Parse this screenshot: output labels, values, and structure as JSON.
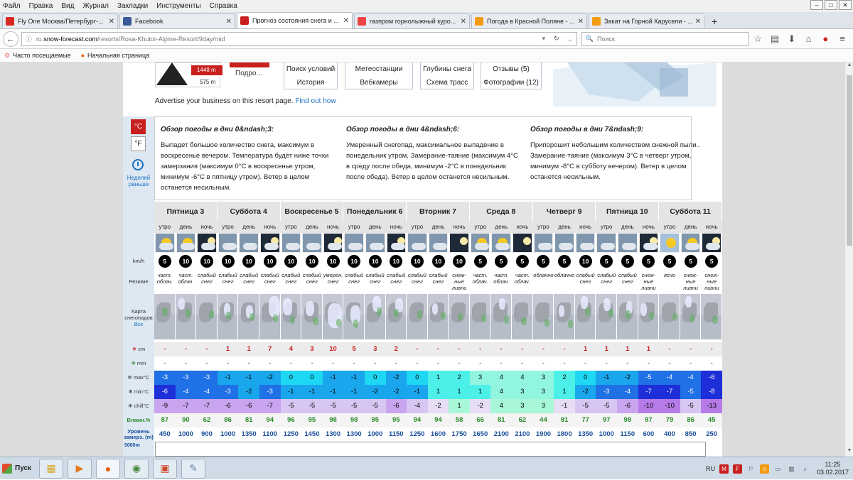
{
  "menu": [
    "Файл",
    "Правка",
    "Вид",
    "Журнал",
    "Закладки",
    "Инструменты",
    "Справка"
  ],
  "tabs": [
    {
      "label": "Fly One Москва/Петербург-...",
      "icon": "aeroflot-icon",
      "color": "#d82a20"
    },
    {
      "label": "Facebook",
      "icon": "facebook-icon",
      "color": "#3b5998"
    },
    {
      "label": "Прогноз состояния снега и ...",
      "icon": "snowforecast-icon",
      "color": "#c8201e",
      "active": true
    },
    {
      "label": "газпром горнолыжный курo...",
      "icon": "yandex-icon",
      "color": "#e44"
    },
    {
      "label": "Погода в Красной Поляне - ...",
      "icon": "weather-icon",
      "color": "#f39c12"
    },
    {
      "label": "Закат на Горной Карусели - ...",
      "icon": "weather-icon",
      "color": "#f39c12"
    }
  ],
  "nav": {
    "url_pre": "ru.",
    "url_host": "snow-forecast.com",
    "url_path": "/resorts/Rosa-Khutor-Alpine-Resort/9day/mid",
    "search_placeholder": "Поиск"
  },
  "bookmarks": [
    "Часто посещаемые",
    "Начальная страница"
  ],
  "header": {
    "elev_top": "1448 m",
    "elev_bottom": "575 m",
    "more": "Подро...",
    "buttons": [
      {
        "a": "Поиск условий",
        "b": "История"
      },
      {
        "a": "Метеостанции",
        "b": "Вебкамеры"
      },
      {
        "a": "Глубины снега",
        "b": "Схема трасс"
      },
      {
        "a": "Отзывы (5)",
        "b": "Фотографии (12)"
      }
    ],
    "advert_text": "Advertise your business on this resort page.",
    "advert_link": "Find out how"
  },
  "side": {
    "celsius": "°C",
    "fahrenheit": "°F",
    "weeks_label": "Неделей раньше"
  },
  "summary": [
    {
      "title": "Обзор погоды в дни 0&ndash;3:",
      "text": "Выпадет большое количество снега, максимум в воскресенье вечером. Температура будет ниже точки замерзания (максимум 0°C в воскресенье утром, минимум -6°C в пятницу утром). Ветер в целом останется несильным."
    },
    {
      "title": "Обзор погоды в дни 4&ndash;6:",
      "text": "Умеренный снегопад, максимальное выпадение в понедельник утром. Замерание-таяние (максимум 4°C в среду после обеда, минимум -2°C в понедельник после обеда). Ветер в целом останется несильным."
    },
    {
      "title": "Обзор погоды в дни 7&ndash;9:",
      "text": "Припорошит небольшим количеством снежной пыли.. Замерание-таяние (максимум 3°C в четверг утром, минимум -8°C в субботу вечером). Ветер в целом останется несильным."
    }
  ],
  "labels": {
    "wind": "km/h",
    "summary": "Резюме",
    "map": "Карта снегопадов",
    "map_all": "Все",
    "snow": "cm",
    "rain": "mm",
    "max": "max°C",
    "min": "min°C",
    "chill": "chill°C",
    "humid": "Влажн.%",
    "freeze": "Уровень замерз. (m)",
    "graph": "5000m"
  },
  "days": [
    "Пятница 3",
    "Суббота 4",
    "Воскресенье 5",
    "Понедельник 6",
    "Вторник 7",
    "Среда 8",
    "Четверг 9",
    "Пятница 10",
    "Суббота 11"
  ],
  "periods": [
    "утро",
    "день",
    "ночь"
  ],
  "icons": [
    "cloudsun",
    "cloudsun",
    "night",
    "snow",
    "snow",
    "snownight",
    "snow",
    "snow",
    "snownight",
    "snow",
    "snow",
    "snownight",
    "snow",
    "snow",
    "moon",
    "cloudsun",
    "cloudsun",
    "moon",
    "cloud",
    "cloud",
    "cloud",
    "snow",
    "snow",
    "snownight",
    "sun",
    "sunsnow",
    "snownight"
  ],
  "wind": [
    5,
    10,
    10,
    10,
    10,
    10,
    10,
    10,
    10,
    10,
    10,
    10,
    10,
    10,
    10,
    5,
    5,
    5,
    5,
    5,
    10,
    5,
    5,
    5,
    5,
    5,
    5
  ],
  "cond": [
    "част. облач.",
    "част. облач.",
    "слабый снег",
    "слабый снег",
    "слабый снег",
    "слабый снег",
    "слабый снег",
    "слабый снег",
    "умерен. снег",
    "слабый снег",
    "слабый снег",
    "слабый снег",
    "слабый снег",
    "слабый снег",
    "снеж-ные ливни",
    "част. облач.",
    "част. облач.",
    "част. облач.",
    "облачно",
    "облачно",
    "слабый снег",
    "слабый снег",
    "слабый снег",
    "снеж-ные ливни",
    "ясно",
    "снеж-ные ливни",
    "снеж-ные ливни"
  ],
  "snow": [
    "-",
    "-",
    "-",
    "1",
    "1",
    "7",
    "4",
    "3",
    "10",
    "5",
    "3",
    "2",
    "-",
    "-",
    "-",
    "-",
    "-",
    "-",
    "-",
    "-",
    "1",
    "1",
    "1",
    "1",
    "-",
    "-",
    "-"
  ],
  "rain": [
    "-",
    "-",
    "-",
    "-",
    "-",
    "-",
    "-",
    "-",
    "-",
    "-",
    "-",
    "-",
    "-",
    "-",
    "-",
    "-",
    "-",
    "-",
    "-",
    "-",
    "-",
    "-",
    "-",
    "-",
    "-",
    "-",
    "-"
  ],
  "max": [
    -3,
    -3,
    -3,
    -1,
    -1,
    -2,
    0,
    0,
    -1,
    -1,
    0,
    -2,
    0,
    1,
    2,
    3,
    4,
    4,
    3,
    2,
    0,
    -1,
    -2,
    -5,
    -4,
    -4,
    -6
  ],
  "min": [
    -6,
    -4,
    -4,
    -3,
    -2,
    -3,
    -1,
    -1,
    -1,
    -1,
    -2,
    -2,
    -1,
    1,
    1,
    1,
    4,
    3,
    3,
    1,
    -2,
    -3,
    -4,
    -7,
    -7,
    -5,
    -8
  ],
  "chill": [
    -9,
    -7,
    -7,
    -6,
    -6,
    -7,
    -5,
    -5,
    -5,
    -5,
    -5,
    -6,
    -4,
    -2,
    1,
    -2,
    4,
    3,
    3,
    -1,
    -5,
    -5,
    -6,
    -10,
    -10,
    -5,
    -13
  ],
  "humid": [
    87,
    90,
    62,
    86,
    81,
    94,
    96,
    95,
    98,
    98,
    95,
    95,
    94,
    94,
    58,
    66,
    81,
    62,
    44,
    81,
    77,
    97,
    98,
    97,
    79,
    86,
    45
  ],
  "freeze": [
    450,
    1000,
    900,
    1000,
    1350,
    1100,
    1250,
    1450,
    1300,
    1300,
    1000,
    1150,
    1250,
    1600,
    1750,
    1650,
    2100,
    2100,
    1900,
    1800,
    1350,
    1000,
    1150,
    600,
    400,
    850,
    250
  ],
  "colors": {
    "red": "#c8201e",
    "link": "#1a6fc2",
    "humid": "#2a8a2a",
    "freeze": "#1a4f9c",
    "snow": "#c8201e"
  },
  "taskbar": {
    "start": "Пуск",
    "lang": "RU",
    "time": "11:25",
    "date": "03.02.2017"
  }
}
